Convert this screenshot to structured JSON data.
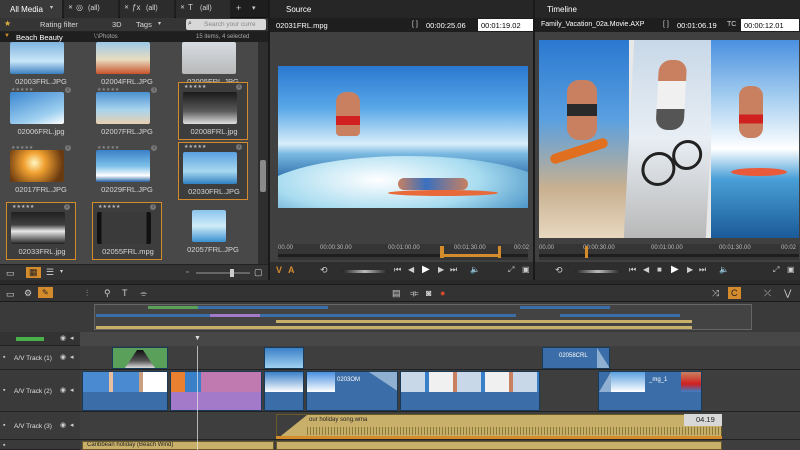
{
  "library": {
    "tabs": [
      {
        "label": "All Media"
      },
      {
        "label": "(all)"
      },
      {
        "label": "(all)"
      },
      {
        "label": "(all)"
      }
    ],
    "filter_bar": {
      "rating_filter": "Rating filter",
      "three_d": "3D",
      "tags": "Tags",
      "search_placeholder": "Search your curre"
    },
    "collection": {
      "name": "Beach Beauty",
      "path": "\\:\\Photos",
      "count": "15 items, 4 selected"
    },
    "items": [
      {
        "label": "02003FRL.JPG"
      },
      {
        "label": "02004FRL.JPG"
      },
      {
        "label": "02005FRL.JPG"
      },
      {
        "label": "02006FRL.jpg"
      },
      {
        "label": "02007FRL.JPG"
      },
      {
        "label": "02008FRL.jpg"
      },
      {
        "label": "02017FRL.JPG"
      },
      {
        "label": "02029FRL.JPG"
      },
      {
        "label": "02030FRL.JPG"
      },
      {
        "label": "02033FRL.jpg"
      },
      {
        "label": "02055FRL.mpg"
      },
      {
        "label": "02057FRL.JPG"
      }
    ]
  },
  "source": {
    "tab": "Source",
    "filename": "02031FRL.mpg",
    "duration": "00:00:25.06",
    "timecode": "00:01:19.02",
    "ruler": [
      "00.00",
      "00:00:30.00",
      "00:01:00.00",
      "00:01:30.00",
      "00:02"
    ]
  },
  "timeline_preview": {
    "tab": "Timeline",
    "filename": "Family_Vacation_02a.Movie.AXP",
    "duration": "00:01:06.19",
    "tc_label": "TC",
    "timecode": "00:00:12.01",
    "ruler": [
      "00.00",
      "00:00:30.00",
      "00:01:00.00",
      "00:01:30.00",
      "00:02"
    ]
  },
  "tracks": [
    {
      "name": "A/V Track (1)"
    },
    {
      "name": "A/V Track (2)"
    },
    {
      "name": "A/V Track (3)"
    }
  ],
  "clips": {
    "track1_title": "02058CRL",
    "track2_a": "0203OM",
    "track2_b": "_mg_1",
    "audio_title": "our holiday song.wma",
    "audio_time": "04.19",
    "bottom_title": "Caribbean holiday (Beach Wind)"
  },
  "colors": {
    "accent": "#d48b2c",
    "selected_border": "#d48b2c",
    "video_clip": "#3b6ea8",
    "audio_clip": "#c9b06a",
    "transition_green": "#5aa05a",
    "transition_purple": "#a27ac9"
  }
}
